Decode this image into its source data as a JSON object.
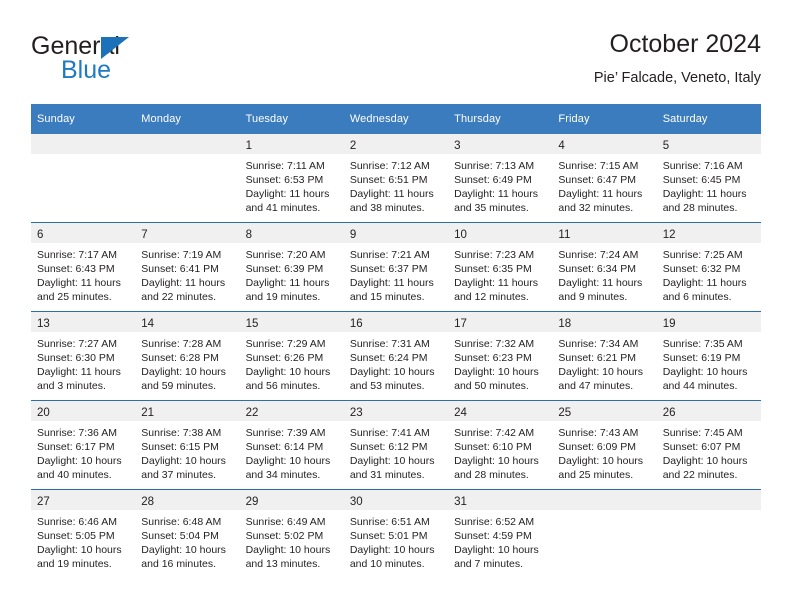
{
  "brand": {
    "line1": "General",
    "line2": "Blue",
    "triangle_color": "#1d71b8",
    "text_color": "#231f20",
    "blue_text_color": "#1f7bc1",
    "logo_icon": "triangle-icon"
  },
  "header": {
    "title": "October 2024",
    "subtitle": "Pie’ Falcade, Veneto, Italy"
  },
  "colors": {
    "header_blue": "#3b7cbe",
    "row_separator": "#2e6da8",
    "daynum_band": "#f0f0f0",
    "text": "#231f20"
  },
  "weekday_headers": [
    "Sunday",
    "Monday",
    "Tuesday",
    "Wednesday",
    "Thursday",
    "Friday",
    "Saturday"
  ],
  "weeks": [
    [
      {
        "day": "",
        "sunrise": "",
        "sunset": "",
        "daylight_line1": "",
        "daylight_line2": ""
      },
      {
        "day": "",
        "sunrise": "",
        "sunset": "",
        "daylight_line1": "",
        "daylight_line2": ""
      },
      {
        "day": "1",
        "sunrise": "Sunrise: 7:11 AM",
        "sunset": "Sunset: 6:53 PM",
        "daylight_line1": "Daylight: 11 hours",
        "daylight_line2": "and 41 minutes."
      },
      {
        "day": "2",
        "sunrise": "Sunrise: 7:12 AM",
        "sunset": "Sunset: 6:51 PM",
        "daylight_line1": "Daylight: 11 hours",
        "daylight_line2": "and 38 minutes."
      },
      {
        "day": "3",
        "sunrise": "Sunrise: 7:13 AM",
        "sunset": "Sunset: 6:49 PM",
        "daylight_line1": "Daylight: 11 hours",
        "daylight_line2": "and 35 minutes."
      },
      {
        "day": "4",
        "sunrise": "Sunrise: 7:15 AM",
        "sunset": "Sunset: 6:47 PM",
        "daylight_line1": "Daylight: 11 hours",
        "daylight_line2": "and 32 minutes."
      },
      {
        "day": "5",
        "sunrise": "Sunrise: 7:16 AM",
        "sunset": "Sunset: 6:45 PM",
        "daylight_line1": "Daylight: 11 hours",
        "daylight_line2": "and 28 minutes."
      }
    ],
    [
      {
        "day": "6",
        "sunrise": "Sunrise: 7:17 AM",
        "sunset": "Sunset: 6:43 PM",
        "daylight_line1": "Daylight: 11 hours",
        "daylight_line2": "and 25 minutes."
      },
      {
        "day": "7",
        "sunrise": "Sunrise: 7:19 AM",
        "sunset": "Sunset: 6:41 PM",
        "daylight_line1": "Daylight: 11 hours",
        "daylight_line2": "and 22 minutes."
      },
      {
        "day": "8",
        "sunrise": "Sunrise: 7:20 AM",
        "sunset": "Sunset: 6:39 PM",
        "daylight_line1": "Daylight: 11 hours",
        "daylight_line2": "and 19 minutes."
      },
      {
        "day": "9",
        "sunrise": "Sunrise: 7:21 AM",
        "sunset": "Sunset: 6:37 PM",
        "daylight_line1": "Daylight: 11 hours",
        "daylight_line2": "and 15 minutes."
      },
      {
        "day": "10",
        "sunrise": "Sunrise: 7:23 AM",
        "sunset": "Sunset: 6:35 PM",
        "daylight_line1": "Daylight: 11 hours",
        "daylight_line2": "and 12 minutes."
      },
      {
        "day": "11",
        "sunrise": "Sunrise: 7:24 AM",
        "sunset": "Sunset: 6:34 PM",
        "daylight_line1": "Daylight: 11 hours",
        "daylight_line2": "and 9 minutes."
      },
      {
        "day": "12",
        "sunrise": "Sunrise: 7:25 AM",
        "sunset": "Sunset: 6:32 PM",
        "daylight_line1": "Daylight: 11 hours",
        "daylight_line2": "and 6 minutes."
      }
    ],
    [
      {
        "day": "13",
        "sunrise": "Sunrise: 7:27 AM",
        "sunset": "Sunset: 6:30 PM",
        "daylight_line1": "Daylight: 11 hours",
        "daylight_line2": "and 3 minutes."
      },
      {
        "day": "14",
        "sunrise": "Sunrise: 7:28 AM",
        "sunset": "Sunset: 6:28 PM",
        "daylight_line1": "Daylight: 10 hours",
        "daylight_line2": "and 59 minutes."
      },
      {
        "day": "15",
        "sunrise": "Sunrise: 7:29 AM",
        "sunset": "Sunset: 6:26 PM",
        "daylight_line1": "Daylight: 10 hours",
        "daylight_line2": "and 56 minutes."
      },
      {
        "day": "16",
        "sunrise": "Sunrise: 7:31 AM",
        "sunset": "Sunset: 6:24 PM",
        "daylight_line1": "Daylight: 10 hours",
        "daylight_line2": "and 53 minutes."
      },
      {
        "day": "17",
        "sunrise": "Sunrise: 7:32 AM",
        "sunset": "Sunset: 6:23 PM",
        "daylight_line1": "Daylight: 10 hours",
        "daylight_line2": "and 50 minutes."
      },
      {
        "day": "18",
        "sunrise": "Sunrise: 7:34 AM",
        "sunset": "Sunset: 6:21 PM",
        "daylight_line1": "Daylight: 10 hours",
        "daylight_line2": "and 47 minutes."
      },
      {
        "day": "19",
        "sunrise": "Sunrise: 7:35 AM",
        "sunset": "Sunset: 6:19 PM",
        "daylight_line1": "Daylight: 10 hours",
        "daylight_line2": "and 44 minutes."
      }
    ],
    [
      {
        "day": "20",
        "sunrise": "Sunrise: 7:36 AM",
        "sunset": "Sunset: 6:17 PM",
        "daylight_line1": "Daylight: 10 hours",
        "daylight_line2": "and 40 minutes."
      },
      {
        "day": "21",
        "sunrise": "Sunrise: 7:38 AM",
        "sunset": "Sunset: 6:15 PM",
        "daylight_line1": "Daylight: 10 hours",
        "daylight_line2": "and 37 minutes."
      },
      {
        "day": "22",
        "sunrise": "Sunrise: 7:39 AM",
        "sunset": "Sunset: 6:14 PM",
        "daylight_line1": "Daylight: 10 hours",
        "daylight_line2": "and 34 minutes."
      },
      {
        "day": "23",
        "sunrise": "Sunrise: 7:41 AM",
        "sunset": "Sunset: 6:12 PM",
        "daylight_line1": "Daylight: 10 hours",
        "daylight_line2": "and 31 minutes."
      },
      {
        "day": "24",
        "sunrise": "Sunrise: 7:42 AM",
        "sunset": "Sunset: 6:10 PM",
        "daylight_line1": "Daylight: 10 hours",
        "daylight_line2": "and 28 minutes."
      },
      {
        "day": "25",
        "sunrise": "Sunrise: 7:43 AM",
        "sunset": "Sunset: 6:09 PM",
        "daylight_line1": "Daylight: 10 hours",
        "daylight_line2": "and 25 minutes."
      },
      {
        "day": "26",
        "sunrise": "Sunrise: 7:45 AM",
        "sunset": "Sunset: 6:07 PM",
        "daylight_line1": "Daylight: 10 hours",
        "daylight_line2": "and 22 minutes."
      }
    ],
    [
      {
        "day": "27",
        "sunrise": "Sunrise: 6:46 AM",
        "sunset": "Sunset: 5:05 PM",
        "daylight_line1": "Daylight: 10 hours",
        "daylight_line2": "and 19 minutes."
      },
      {
        "day": "28",
        "sunrise": "Sunrise: 6:48 AM",
        "sunset": "Sunset: 5:04 PM",
        "daylight_line1": "Daylight: 10 hours",
        "daylight_line2": "and 16 minutes."
      },
      {
        "day": "29",
        "sunrise": "Sunrise: 6:49 AM",
        "sunset": "Sunset: 5:02 PM",
        "daylight_line1": "Daylight: 10 hours",
        "daylight_line2": "and 13 minutes."
      },
      {
        "day": "30",
        "sunrise": "Sunrise: 6:51 AM",
        "sunset": "Sunset: 5:01 PM",
        "daylight_line1": "Daylight: 10 hours",
        "daylight_line2": "and 10 minutes."
      },
      {
        "day": "31",
        "sunrise": "Sunrise: 6:52 AM",
        "sunset": "Sunset: 4:59 PM",
        "daylight_line1": "Daylight: 10 hours",
        "daylight_line2": "and 7 minutes."
      },
      {
        "day": "",
        "sunrise": "",
        "sunset": "",
        "daylight_line1": "",
        "daylight_line2": ""
      },
      {
        "day": "",
        "sunrise": "",
        "sunset": "",
        "daylight_line1": "",
        "daylight_line2": ""
      }
    ]
  ]
}
